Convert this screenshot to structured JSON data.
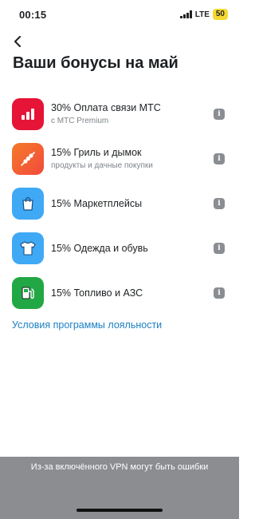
{
  "status_bar": {
    "time": "00:15",
    "network": "LTE",
    "battery": "50"
  },
  "header": {
    "back_icon": "chevron-left-icon",
    "title": "Ваши бонусы на май"
  },
  "bonuses": [
    {
      "title": "30% Оплата связи МТС",
      "subtitle": "с МТС Premium",
      "icon": "bars-chart-icon",
      "color": "#e61436"
    },
    {
      "title": "15% Гриль и дымок",
      "subtitle": "продукты и дачные покупки",
      "icon": "skewer-icon",
      "color": "#f46a2e"
    },
    {
      "title": "15% Маркетплейсы",
      "subtitle": "",
      "icon": "shopping-bag-icon",
      "color": "#3fa9f5"
    },
    {
      "title": "15% Одежда и обувь",
      "subtitle": "",
      "icon": "tshirt-icon",
      "color": "#3fa9f5"
    },
    {
      "title": "15% Топливо и АЗС",
      "subtitle": "",
      "icon": "fuel-pump-icon",
      "color": "#22a745"
    }
  ],
  "terms_link": "Условия программы лояльности",
  "vpn_banner": "Из-за включённого VPN могут быть ошибки"
}
